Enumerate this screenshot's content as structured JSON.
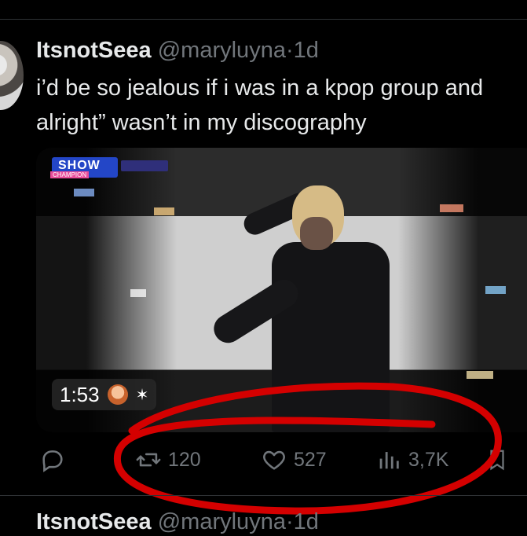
{
  "tweet": {
    "display_name": "ItsnotSeea",
    "handle": "@maryluyna",
    "separator": "·",
    "time": "1d",
    "text": "i’d be so jealous if i was in a kpop group and\nalright” wasn’t in my discography"
  },
  "media": {
    "show_logo": "SHOW",
    "show_logo_sub": "CHAMPION",
    "duration": "1:53",
    "badge_icon": "star-icon"
  },
  "actions": {
    "reply_icon": "reply-icon",
    "retweet_icon": "retweet-icon",
    "retweet_count": "120",
    "like_icon": "heart-icon",
    "like_count": "527",
    "views_icon": "views-icon",
    "views_count": "3,7K",
    "bookmark_icon": "bookmark-icon"
  },
  "next_tweet": {
    "display_name": "ItsnotSeea",
    "handle": "@maryluyna",
    "separator": "·",
    "time": "1d"
  },
  "colors": {
    "background": "#000000",
    "text": "#e7e9ea",
    "muted": "#71767b",
    "annotation": "#d40000"
  }
}
